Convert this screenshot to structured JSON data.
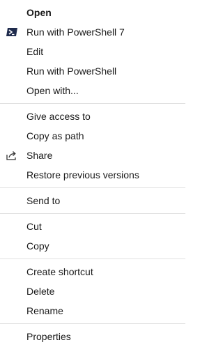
{
  "menu": {
    "open": "Open",
    "run_ps7": "Run with PowerShell 7",
    "edit": "Edit",
    "run_ps": "Run with PowerShell",
    "open_with": "Open with...",
    "give_access": "Give access to",
    "copy_as_path": "Copy as path",
    "share": "Share",
    "restore_versions": "Restore previous versions",
    "send_to": "Send to",
    "cut": "Cut",
    "copy": "Copy",
    "create_shortcut": "Create shortcut",
    "delete": "Delete",
    "rename": "Rename",
    "properties": "Properties"
  },
  "icons": {
    "powershell": "powershell-icon",
    "share": "share-icon"
  },
  "colors": {
    "powershell_bg": "#1f2b4d",
    "separator": "#e0e0e0"
  }
}
